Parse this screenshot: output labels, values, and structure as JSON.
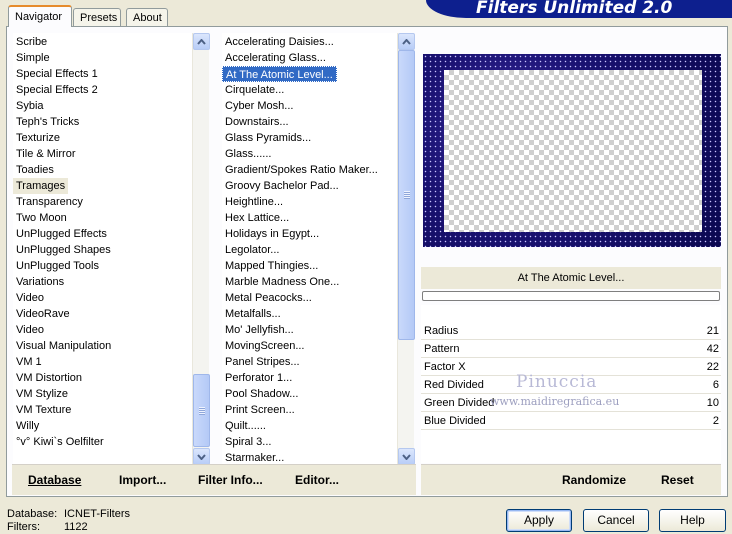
{
  "header": {
    "title": "Filters Unlimited 2.0"
  },
  "tabs": [
    {
      "label": "Navigator"
    },
    {
      "label": "Presets"
    },
    {
      "label": "About"
    }
  ],
  "categories": {
    "items": [
      "Scribe",
      "Simple",
      "Special Effects 1",
      "Special Effects 2",
      "Sybia",
      "Teph's Tricks",
      "Texturize",
      "Tile & Mirror",
      "Toadies",
      "Tramages",
      "Transparency",
      "Two Moon",
      "UnPlugged Effects",
      "UnPlugged Shapes",
      "UnPlugged Tools",
      "Variations",
      "Video",
      "VideoRave",
      "Video",
      "Visual Manipulation",
      "VM 1",
      "VM Distortion",
      "VM Stylize",
      "VM Texture",
      "Willy",
      "°v° Kiwi`s Oelfilter"
    ],
    "current": "Tramages"
  },
  "filters": {
    "items": [
      "Accelerating Daisies...",
      "Accelerating Glass...",
      "At The Atomic Level...",
      "Cirquelate...",
      "Cyber Mosh...",
      "Downstairs...",
      "Glass Pyramids...",
      "Glass......",
      "Gradient/Spokes Ratio Maker...",
      "Groovy Bachelor Pad...",
      "Heightline...",
      "Hex Lattice...",
      "Holidays in Egypt...",
      "Legolator...",
      "Mapped Thingies...",
      "Marble Madness One...",
      "Metal Peacocks...",
      "Metalfalls...",
      "Mo' Jellyfish...",
      "MovingScreen...",
      "Panel Stripes...",
      "Perforator 1...",
      "Pool Shadow...",
      "Print Screen...",
      "Quilt......",
      "Spiral 3...",
      "Starmaker..."
    ],
    "selected": "At The Atomic Level..."
  },
  "panel_buttons": {
    "database": "Database",
    "import": "Import...",
    "filter_info": "Filter Info...",
    "editor": "Editor...",
    "randomize": "Randomize",
    "reset": "Reset"
  },
  "preview": {
    "filter_name": "At The Atomic Level...",
    "progress_fraction": 0
  },
  "params": [
    {
      "name": "Radius",
      "value": "21"
    },
    {
      "name": "Pattern",
      "value": "42"
    },
    {
      "name": "Factor X",
      "value": "22"
    },
    {
      "name": "Red Divided",
      "value": "6"
    },
    {
      "name": "Green Divided",
      "value": "10"
    },
    {
      "name": "Blue Divided",
      "value": "2"
    }
  ],
  "watermark": {
    "name": "Pinuccia",
    "site": "www.maidiregrafica.eu"
  },
  "status": {
    "database_label": "Database:",
    "database_value": "ICNET-Filters",
    "filters_label": "Filters:",
    "filters_value": "1122"
  },
  "dialog_buttons": {
    "apply": "Apply",
    "cancel": "Cancel",
    "help": "Help"
  },
  "colors": {
    "selection": "#316ac5",
    "banner": "#0d1f8e",
    "window_bg": "#ece9d8"
  }
}
